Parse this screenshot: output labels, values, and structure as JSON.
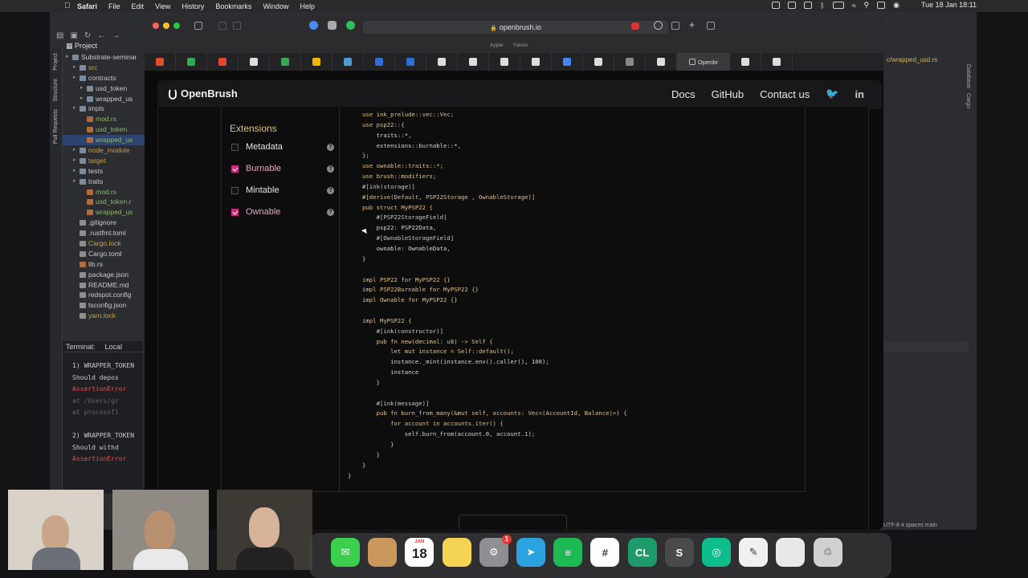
{
  "menubar": {
    "app_name": "Safari",
    "items": [
      "File",
      "Edit",
      "View",
      "History",
      "Bookmarks",
      "Window",
      "Help"
    ],
    "clock": "Tue 18 Jan  18:11"
  },
  "ide": {
    "project_label": "Project",
    "tree": [
      {
        "label": "Substrate-seminar",
        "indent": 0,
        "kind": "folder"
      },
      {
        "label": "src",
        "indent": 1,
        "kind": "folder"
      },
      {
        "label": "contracts",
        "indent": 1,
        "kind": "folder"
      },
      {
        "label": "usd_token",
        "indent": 2,
        "kind": "folder"
      },
      {
        "label": "wrapped_us",
        "indent": 2,
        "kind": "folder"
      },
      {
        "label": "impls",
        "indent": 1,
        "kind": "folder"
      },
      {
        "label": "mod.rs",
        "indent": 2,
        "kind": "rs"
      },
      {
        "label": "usd_token.",
        "indent": 2,
        "kind": "rs"
      },
      {
        "label": "wrapped_us",
        "indent": 2,
        "kind": "rs",
        "selected": true
      },
      {
        "label": "node_module",
        "indent": 1,
        "kind": "folder"
      },
      {
        "label": "target",
        "indent": 1,
        "kind": "folder"
      },
      {
        "label": "tests",
        "indent": 1,
        "kind": "folder"
      },
      {
        "label": "traits",
        "indent": 1,
        "kind": "folder"
      },
      {
        "label": "mod.rs",
        "indent": 2,
        "kind": "rs"
      },
      {
        "label": "usd_token.r",
        "indent": 2,
        "kind": "rs"
      },
      {
        "label": "wrapped_us",
        "indent": 2,
        "kind": "rs"
      },
      {
        "label": ".gitignore",
        "indent": 1,
        "kind": "cfg"
      },
      {
        "label": ".rustfmt.toml",
        "indent": 1,
        "kind": "cfg"
      },
      {
        "label": "Cargo.lock",
        "indent": 1,
        "kind": "cfg"
      },
      {
        "label": "Cargo.toml",
        "indent": 1,
        "kind": "cfg"
      },
      {
        "label": "lib.rs",
        "indent": 1,
        "kind": "rs"
      },
      {
        "label": "package.json",
        "indent": 1,
        "kind": "cfg"
      },
      {
        "label": "README.md",
        "indent": 1,
        "kind": "cfg"
      },
      {
        "label": "redspot.config",
        "indent": 1,
        "kind": "cfg"
      },
      {
        "label": "tsconfig.json",
        "indent": 1,
        "kind": "cfg"
      },
      {
        "label": "yarn.lock",
        "indent": 1,
        "kind": "cfg"
      }
    ],
    "terminal": {
      "tab_terminal": "Terminal:",
      "tab_local": "Local",
      "lines": [
        {
          "text": "1) WRAPPER_TOKEN",
          "cls": ""
        },
        {
          "text": "   Should depos",
          "cls": ""
        },
        {
          "text": "   AssertionError",
          "cls": "err"
        },
        {
          "text": "    at /Users/gr",
          "cls": "dim"
        },
        {
          "text": "    at processTi",
          "cls": "dim"
        },
        {
          "text": "",
          "cls": ""
        },
        {
          "text": "2) WRAPPER_TOKEN",
          "cls": ""
        },
        {
          "text": "   Should withd",
          "cls": ""
        },
        {
          "text": "   AssertionError",
          "cls": "err"
        }
      ]
    },
    "right_tab": "c/wrapped_usd.rs",
    "status": "UTF-8   4 spaces   main"
  },
  "safari": {
    "url": "openbrush.io",
    "favorites": [
      "Apple",
      "Yahoo"
    ],
    "active_tab_label": "Openbr",
    "tab_colors": [
      "#e44d26",
      "#34a853",
      "#ea4335",
      "#dddddd",
      "#34a853",
      "#f4b400",
      "#4e9bd6",
      "#2d6fd6",
      "#2d6fd6",
      "#dddddd",
      "#dddddd",
      "#dddddd",
      "#dddddd",
      "#4285f4",
      "#dddddd",
      "#888888",
      "#dddddd",
      "#dddddd",
      "#dddddd"
    ]
  },
  "openbrush": {
    "brand": "OpenBrush",
    "nav": [
      "Docs",
      "GitHub",
      "Contact us"
    ],
    "extensions_title": "Extensions",
    "extensions": [
      {
        "label": "Metadata",
        "checked": false
      },
      {
        "label": "Burnable",
        "checked": true
      },
      {
        "label": "Mintable",
        "checked": false
      },
      {
        "label": "Ownable",
        "checked": true
      }
    ],
    "help_glyph": "?",
    "code_lines": [
      "use ink_prelude::vec::Vec;",
      "use psp22::{",
      "    traits::*,",
      "    extensions::burnable::*,",
      "};",
      "use ownable::traits::*;",
      "use brush::modifiers;",
      "#[ink(storage)]",
      "#[derive(Default, PSP22Storage , OwnableStorage)]",
      "pub struct MyPSP22 {",
      "    #[PSP22StorageField]",
      "    psp22: PSP22Data,",
      "    #[OwnableStorageField]",
      "    ownable: OwnableData,",
      "}",
      "",
      "impl PSP22 for MyPSP22 {}",
      "impl PSP22Burnable for MyPSP22 {}",
      "impl Ownable for MyPSP22 {}",
      "",
      "impl MyPSP22 {",
      "    #[ink(constructor)]",
      "    pub fn new(decimal: u8) -> Self {",
      "        let mut instance = Self::default();",
      "        instance._mint(instance.env().caller(), 100);",
      "        instance",
      "    }",
      "",
      "    #[ink(message)]",
      "    pub fn burn_from_many(&mut self, accounts: Vec<(AccountId, Balance)>) {",
      "        for account in accounts.iter() {",
      "            self.burn_from(account.0, account.1);",
      "        }",
      "    }",
      "}",
      "}"
    ]
  },
  "dock": {
    "calendar_month": "JAN",
    "calendar_day": "18",
    "badge": "1",
    "apps": [
      {
        "name": "messages",
        "color": "#3ccf4e",
        "glyph": "✉"
      },
      {
        "name": "finder-box",
        "color": "#c9985a",
        "glyph": ""
      },
      {
        "name": "calendar",
        "color": "#ffffff",
        "glyph": ""
      },
      {
        "name": "notes",
        "color": "#f5d454",
        "glyph": ""
      },
      {
        "name": "system-settings",
        "color": "#8e8e93",
        "glyph": "⚙"
      },
      {
        "name": "telegram",
        "color": "#2aa3e0",
        "glyph": "➤"
      },
      {
        "name": "spotify",
        "color": "#1db954",
        "glyph": "≡"
      },
      {
        "name": "slack",
        "color": "#ffffff",
        "glyph": "#"
      },
      {
        "name": "clion",
        "color": "#1e9a6b",
        "glyph": "CL"
      },
      {
        "name": "sublime",
        "color": "#4a4a4a",
        "glyph": "S"
      },
      {
        "name": "element",
        "color": "#0dbd8b",
        "glyph": "◎"
      },
      {
        "name": "textedit",
        "color": "#f0f0f0",
        "glyph": "✎"
      },
      {
        "name": "files",
        "color": "#e8e8e8",
        "glyph": ""
      },
      {
        "name": "trash",
        "color": "#d0d0d0",
        "glyph": "♲"
      }
    ]
  }
}
